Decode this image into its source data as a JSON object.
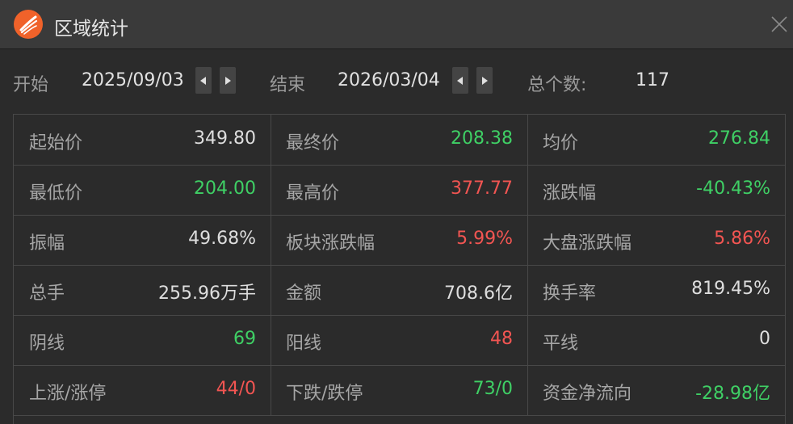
{
  "window": {
    "title": "区域统计"
  },
  "range": {
    "start_label": "开始",
    "start_date": "2025/09/03",
    "end_label": "结束",
    "end_date": "2026/03/04",
    "count_label": "总个数:",
    "count_value": "117"
  },
  "colors": {
    "up": "#f25552",
    "down": "#3fd065",
    "neutral": "#dedede"
  },
  "stats": [
    [
      {
        "label": "起始价",
        "value": "349.80",
        "tone": "white"
      },
      {
        "label": "最终价",
        "value": "208.38",
        "tone": "green"
      },
      {
        "label": "均价",
        "value": "276.84",
        "tone": "green"
      }
    ],
    [
      {
        "label": "最低价",
        "value": "204.00",
        "tone": "green"
      },
      {
        "label": "最高价",
        "value": "377.77",
        "tone": "red"
      },
      {
        "label": "涨跌幅",
        "value": "-40.43%",
        "tone": "green"
      }
    ],
    [
      {
        "label": "振幅",
        "value": "49.68%",
        "tone": "white"
      },
      {
        "label": "板块涨跌幅",
        "value": "5.99%",
        "tone": "red"
      },
      {
        "label": "大盘涨跌幅",
        "value": "5.86%",
        "tone": "red"
      }
    ],
    [
      {
        "label": "总手",
        "value": "255.96万手",
        "tone": "white"
      },
      {
        "label": "金额",
        "value": "708.6亿",
        "tone": "white"
      },
      {
        "label": "换手率",
        "value": "819.45%",
        "tone": "white"
      }
    ],
    [
      {
        "label": "阴线",
        "value": "69",
        "tone": "green"
      },
      {
        "label": "阳线",
        "value": "48",
        "tone": "red"
      },
      {
        "label": "平线",
        "value": "0",
        "tone": "white"
      }
    ],
    [
      {
        "label": "上涨/涨停",
        "value": "44/0",
        "tone": "red"
      },
      {
        "label": "下跌/跌停",
        "value": "73/0",
        "tone": "green"
      },
      {
        "label": "资金净流向",
        "value": "-28.98亿",
        "tone": "green"
      }
    ]
  ]
}
